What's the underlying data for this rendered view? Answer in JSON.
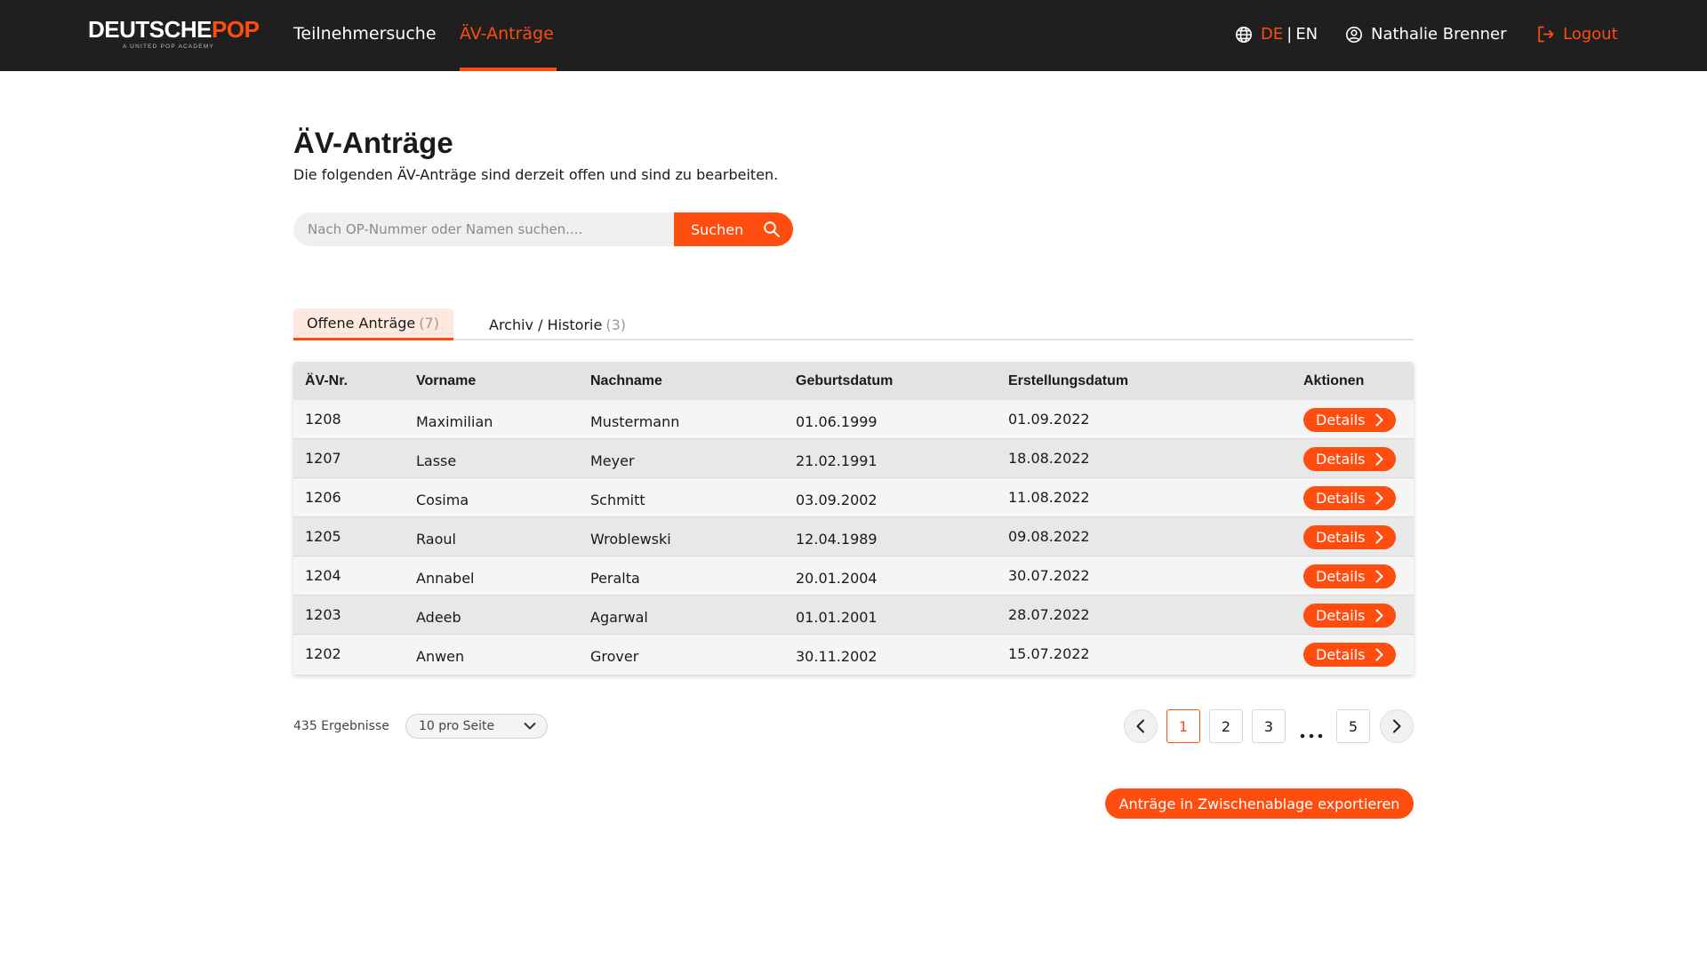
{
  "brand": {
    "logo_part1": "DEUTSCHE",
    "logo_part2": "POP",
    "tagline": "A UNITED POP ACADEMY",
    "accent_color": "#ff4d0f",
    "topbar_color": "#1f1f1f"
  },
  "nav": {
    "items": [
      {
        "label": "Teilnehmersuche",
        "active": false
      },
      {
        "label": "ÄV-Anträge",
        "active": true
      }
    ],
    "lang_de": "DE",
    "lang_sep": "|",
    "lang_en": "EN",
    "lang_icon": "globe-icon",
    "user_name": "Nathalie Brenner",
    "user_icon": "user-circle-icon",
    "logout_label": "Logout",
    "logout_icon": "logout-icon"
  },
  "page": {
    "title": "ÄV-Anträge",
    "subtitle": "Die folgenden ÄV-Anträge sind derzeit offen und sind zu bearbeiten."
  },
  "search": {
    "placeholder": "Nach OP-Nummer oder Namen suchen....",
    "value": "",
    "button_label": "Suchen",
    "button_icon": "search-icon"
  },
  "tabs": [
    {
      "label": "Offene Anträge",
      "count": "(7)",
      "active": true
    },
    {
      "label": "Archiv / Historie",
      "count": "(3)",
      "active": false
    }
  ],
  "table": {
    "headers": [
      "ÄV-Nr.",
      "Vorname",
      "Nachname",
      "Geburtsdatum",
      "Erstellungsdatum",
      "Aktionen"
    ],
    "rows": [
      {
        "nr": "1208",
        "vorname": "Maximilian",
        "nachname": "Mustermann",
        "geburtsdatum": "01.06.1999",
        "erstellungsdatum": "01.09.2022",
        "action": "Details"
      },
      {
        "nr": "1207",
        "vorname": "Lasse",
        "nachname": "Meyer",
        "geburtsdatum": "21.02.1991",
        "erstellungsdatum": "18.08.2022",
        "action": "Details"
      },
      {
        "nr": "1206",
        "vorname": "Cosima",
        "nachname": "Schmitt",
        "geburtsdatum": "03.09.2002",
        "erstellungsdatum": "11.08.2022",
        "action": "Details"
      },
      {
        "nr": "1205",
        "vorname": "Raoul",
        "nachname": "Wroblewski",
        "geburtsdatum": "12.04.1989",
        "erstellungsdatum": "09.08.2022",
        "action": "Details"
      },
      {
        "nr": "1204",
        "vorname": "Annabel",
        "nachname": "Peralta",
        "geburtsdatum": "20.01.2004",
        "erstellungsdatum": "30.07.2022",
        "action": "Details"
      },
      {
        "nr": "1203",
        "vorname": "Adeeb",
        "nachname": "Agarwal",
        "geburtsdatum": "01.01.2001",
        "erstellungsdatum": "28.07.2022",
        "action": "Details"
      },
      {
        "nr": "1202",
        "vorname": "Anwen",
        "nachname": "Grover",
        "geburtsdatum": "30.11.2002",
        "erstellungsdatum": "15.07.2022",
        "action": "Details"
      }
    ]
  },
  "footer": {
    "results_text": "435 Ergebnisse",
    "per_page_selected": "10 pro Seite",
    "pagination": {
      "pages": [
        "1",
        "2",
        "3",
        "5"
      ],
      "current": "1",
      "ellipsis": true
    },
    "export_label": "Anträge in Zwischenablage exportieren"
  }
}
